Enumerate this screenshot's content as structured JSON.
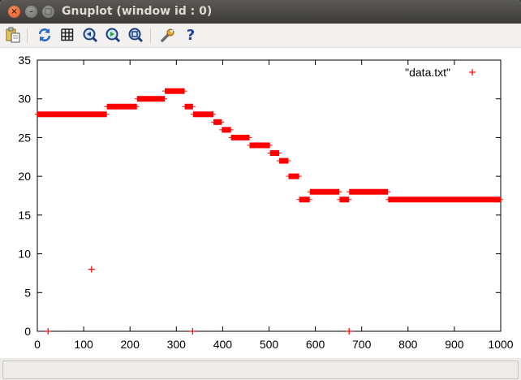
{
  "window": {
    "title": "Gnuplot (window id : 0)"
  },
  "toolbar": {
    "icons": [
      "copy-to-clipboard-icon",
      "replot-icon",
      "grid-icon",
      "zoom-previous-icon",
      "zoom-next-icon",
      "autoscale-icon",
      "configure-icon",
      "help-icon"
    ],
    "help_glyph": "?"
  },
  "status": {
    "text": ""
  },
  "chart_data": {
    "type": "scatter",
    "title": "",
    "xlabel": "",
    "ylabel": "",
    "xlim": [
      0,
      1000
    ],
    "ylim": [
      0,
      35
    ],
    "xticks": [
      "0",
      "100",
      "200",
      "300",
      "400",
      "500",
      "600",
      "700",
      "800",
      "900",
      "1000"
    ],
    "yticks": [
      "0",
      "5",
      "10",
      "15",
      "20",
      "25",
      "30",
      "35"
    ],
    "grid": false,
    "legend": "top-right",
    "marker": "+",
    "series_color": "#ff0000",
    "series": [
      {
        "name": "\"data.txt\"",
        "runs": [
          {
            "x_start": 0,
            "x_end": 150,
            "y": 28
          },
          {
            "x_start": 150,
            "x_end": 215,
            "y": 29
          },
          {
            "x_start": 215,
            "x_end": 275,
            "y": 30
          },
          {
            "x_start": 275,
            "x_end": 318,
            "y": 31
          },
          {
            "x_start": 318,
            "x_end": 336,
            "y": 29
          },
          {
            "x_start": 336,
            "x_end": 380,
            "y": 28
          },
          {
            "x_start": 380,
            "x_end": 398,
            "y": 27
          },
          {
            "x_start": 398,
            "x_end": 418,
            "y": 26
          },
          {
            "x_start": 418,
            "x_end": 458,
            "y": 25
          },
          {
            "x_start": 458,
            "x_end": 502,
            "y": 24
          },
          {
            "x_start": 502,
            "x_end": 522,
            "y": 23
          },
          {
            "x_start": 522,
            "x_end": 542,
            "y": 22
          },
          {
            "x_start": 542,
            "x_end": 565,
            "y": 20
          },
          {
            "x_start": 565,
            "x_end": 588,
            "y": 17
          },
          {
            "x_start": 588,
            "x_end": 652,
            "y": 18
          },
          {
            "x_start": 652,
            "x_end": 673,
            "y": 17
          },
          {
            "x_start": 673,
            "x_end": 757,
            "y": 18
          },
          {
            "x_start": 757,
            "x_end": 1000,
            "y": 17
          }
        ],
        "points": [
          {
            "x": 23,
            "y": 0
          },
          {
            "x": 117,
            "y": 8
          },
          {
            "x": 335,
            "y": 0
          },
          {
            "x": 673,
            "y": 0
          }
        ]
      }
    ]
  }
}
